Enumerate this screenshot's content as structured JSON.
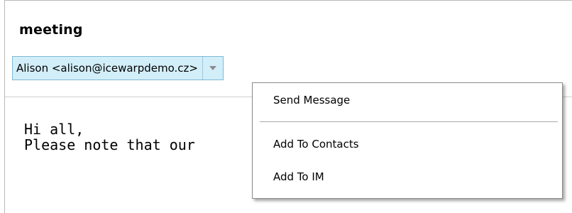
{
  "message": {
    "subject": "meeting",
    "sender_chip": "Alison <alison@icewarpdemo.cz>",
    "body_lines": [
      "Hi all,",
      "Please note that our"
    ]
  },
  "context_menu": {
    "items": [
      {
        "label": "Send Message"
      },
      {
        "label": "Add To Contacts"
      },
      {
        "label": "Add To IM"
      }
    ]
  },
  "colors": {
    "chip_background": "#d2eef9",
    "chip_border": "#7fb8d4",
    "menu_border": "#8a8a8a"
  },
  "icons": {
    "sender_dropdown": "chevron-down-icon"
  }
}
